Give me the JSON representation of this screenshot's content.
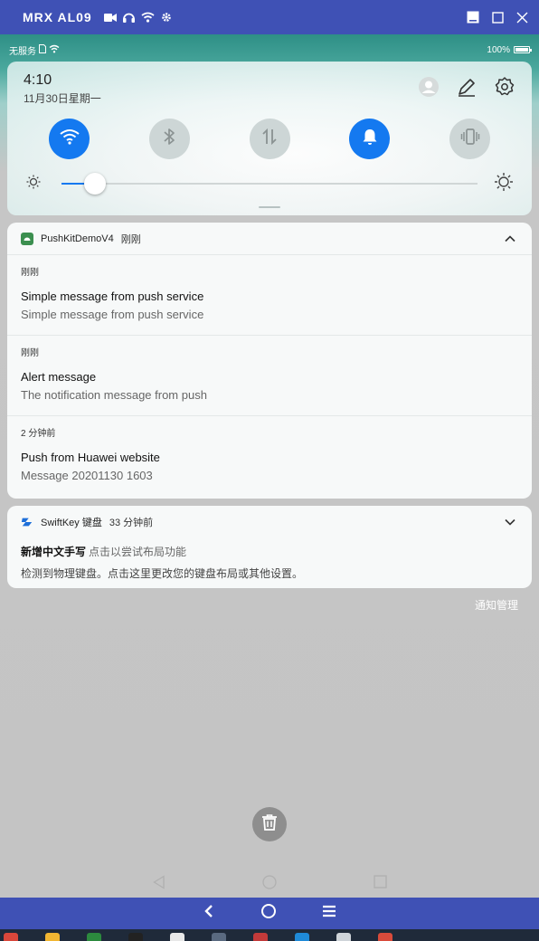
{
  "window": {
    "title": "MRX AL09",
    "icons": [
      "video-icon",
      "headset-icon",
      "wifi-icon",
      "gear-icon"
    ],
    "controls": [
      "minimize-icon",
      "maximize-icon",
      "close-icon"
    ]
  },
  "status_bar": {
    "carrier": "无服务",
    "battery": "100%"
  },
  "quick_settings": {
    "time": "4:10",
    "date": "11月30日星期一",
    "actions": [
      "avatar-icon",
      "edit-icon",
      "settings-icon"
    ],
    "toggles": [
      {
        "name": "wifi",
        "on": true
      },
      {
        "name": "bluetooth",
        "on": false
      },
      {
        "name": "mobile-data",
        "on": false
      },
      {
        "name": "sound",
        "on": true
      },
      {
        "name": "vibrate",
        "on": false
      }
    ],
    "brightness_level": 0.08,
    "accent_color": "#1479f0"
  },
  "pushkit": {
    "app_name": "PushKitDemoV4",
    "time": "刚刚",
    "notifications": [
      {
        "time": "刚刚",
        "title": "Simple message from push service",
        "text": "Simple message from push service"
      },
      {
        "time": "刚刚",
        "title": "Alert message",
        "text": "The notification message from push"
      },
      {
        "time": "2 分钟前",
        "title": "Push from Huawei website",
        "text": "Message 20201130 1603"
      }
    ]
  },
  "swiftkey": {
    "app_name": "SwiftKey 键盘",
    "time": "33 分钟前",
    "title": "新增中文手写",
    "title_rest": "点击以尝试布局功能",
    "text": "检测到物理键盘。点击这里更改您的键盘布局或其他设置。"
  },
  "notification_manage": "通知管理",
  "colors": {
    "emulator_bar": "#3f51b5",
    "accent": "#1479f0"
  }
}
